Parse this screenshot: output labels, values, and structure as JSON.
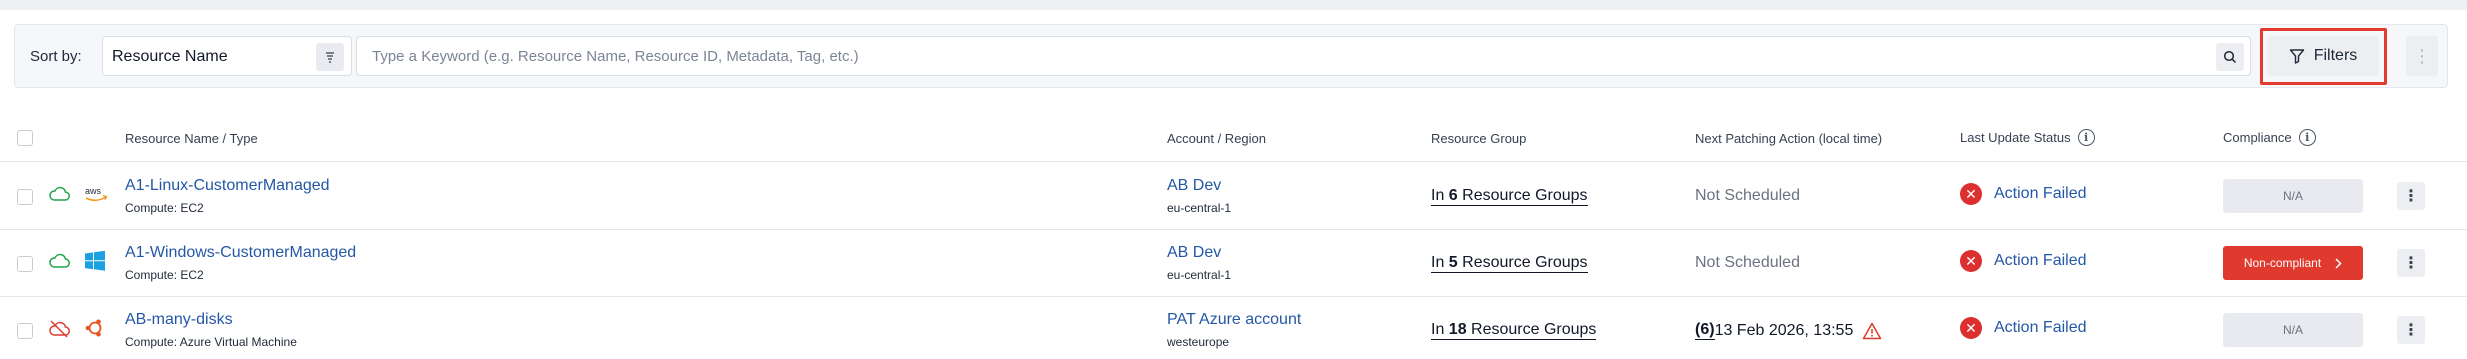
{
  "toolbar": {
    "sort_label": "Sort by:",
    "sort_value": "Resource Name",
    "search_placeholder": "Type a Keyword (e.g. Resource Name, Resource ID, Metadata, Tag, etc.)",
    "filters_label": "Filters",
    "more_label": "⋮"
  },
  "table": {
    "headers": {
      "resource": "Resource Name / Type",
      "account": "Account / Region",
      "group": "Resource Group",
      "patching": "Next Patching Action (local time)",
      "status": "Last Update Status",
      "compliance": "Compliance"
    },
    "rows": [
      {
        "cloud_icon": "cloud-icon",
        "provider_icon": "aws-icon",
        "name": "A1-Linux-CustomerManaged",
        "type": "Compute: EC2",
        "account": "AB Dev",
        "region": "eu-central-1",
        "group_prefix": "In ",
        "group_count": "6",
        "group_suffix": " Resource Groups",
        "patching": "Not Scheduled",
        "status": "Action Failed",
        "compliance": "N/A"
      },
      {
        "cloud_icon": "cloud-icon",
        "provider_icon": "windows-icon",
        "name": "A1-Windows-CustomerManaged",
        "type": "Compute: EC2",
        "account": "AB Dev",
        "region": "eu-central-1",
        "group_prefix": "In ",
        "group_count": "5",
        "group_suffix": " Resource Groups",
        "patching": "Not Scheduled",
        "status": "Action Failed",
        "compliance": "Non-compliant"
      },
      {
        "cloud_icon": "cloud-off-icon",
        "provider_icon": "ubuntu-icon",
        "name": "AB-many-disks",
        "type": "Compute: Azure Virtual Machine",
        "account": "PAT Azure account",
        "region": "westeurope",
        "group_prefix": "In ",
        "group_count": "18",
        "group_suffix": " Resource Groups",
        "patching_count": "(6)",
        "patching_date": " 13 Feb 2026, 13:55",
        "status": "Action Failed",
        "compliance": "N/A"
      }
    ]
  },
  "colors": {
    "link": "#2457a6",
    "danger": "#e03a2f",
    "online": "#22a34a",
    "warning": "#e8a317"
  }
}
